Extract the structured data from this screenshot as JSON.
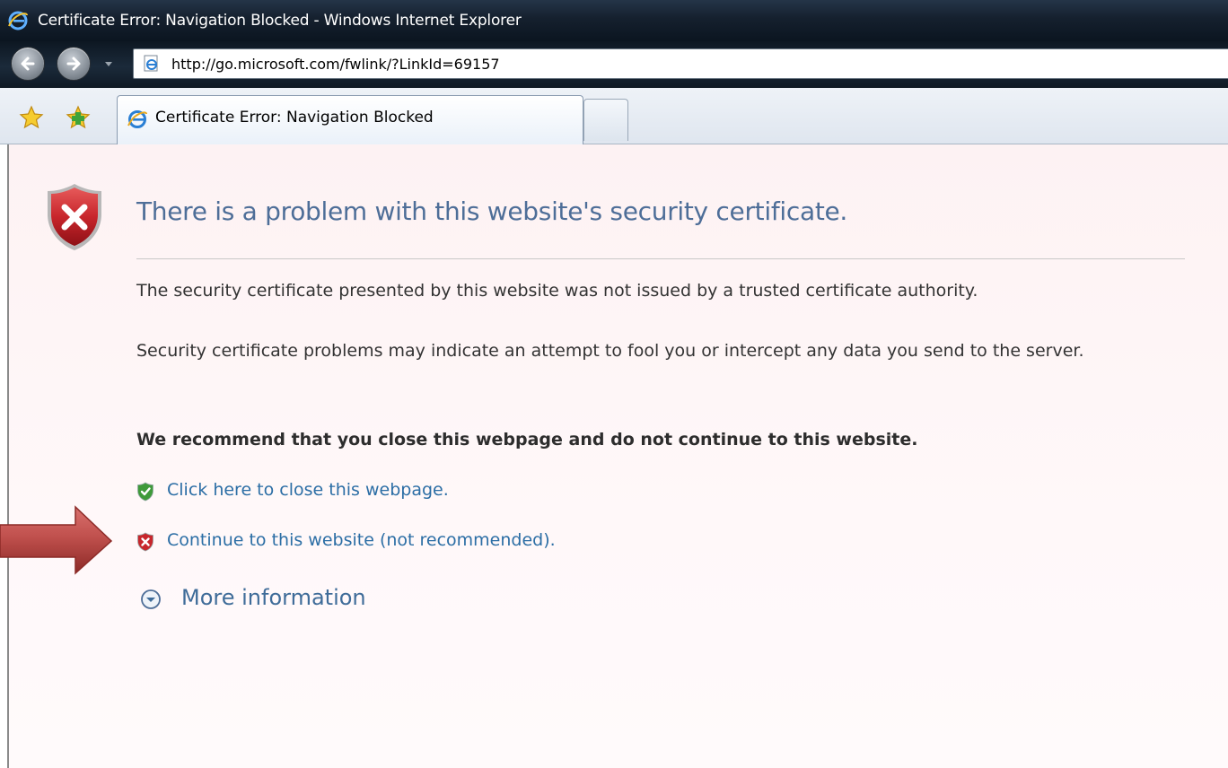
{
  "window": {
    "title": "Certificate Error: Navigation Blocked - Windows Internet Explorer"
  },
  "navbar": {
    "address_url": "http://go.microsoft.com/fwlink/?LinkId=69157"
  },
  "tabs": [
    {
      "label": "Certificate Error: Navigation Blocked",
      "active": true
    }
  ],
  "page": {
    "title": "There is a problem with this website's security certificate.",
    "paragraph1": "The security certificate presented by this website was not issued by a trusted certificate authority.",
    "paragraph2": "Security certificate problems may indicate an attempt to fool you or intercept any data you send to the server.",
    "recommendation": "We recommend that you close this webpage and do not continue to this website.",
    "link_close": "Click here to close this webpage.",
    "link_continue": "Continue to this website (not recommended).",
    "more_info": "More information"
  },
  "colors": {
    "title_text": "#4e6e98",
    "link_text": "#2c6ea5",
    "error_shield": "#c8262c",
    "safe_shield": "#3f9a3a",
    "annotation_arrow": "#c0504d"
  },
  "icons": {
    "title_bar": "ie-logo-icon",
    "address": "ie-page-icon",
    "favorites": "favorites-star-icon",
    "add_favorites": "add-favorites-icon",
    "error": "error-shield-icon",
    "safe_link": "green-shield-check-icon",
    "unsafe_link": "red-shield-x-icon",
    "expand": "expand-chevron-icon",
    "annotation": "annotation-arrow-icon"
  }
}
